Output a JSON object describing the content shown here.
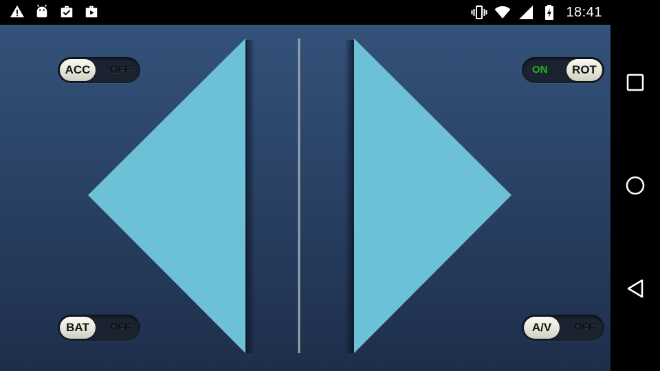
{
  "status_bar": {
    "time": "18:41",
    "left_icons": [
      "warning-icon",
      "android-icon",
      "briefcase-check-icon",
      "briefcase-play-icon"
    ],
    "right_icons": [
      "vibrate-icon",
      "wifi-icon",
      "cell-signal-icon",
      "battery-charging-icon"
    ]
  },
  "controls": {
    "acc": {
      "label": "ACC",
      "state": "OFF",
      "on": false
    },
    "rot": {
      "label": "ROT",
      "state": "ON",
      "on": true
    },
    "bat": {
      "label": "BAT",
      "state": "OFF",
      "on": false
    },
    "av": {
      "label": "A/V",
      "state": "OFF",
      "on": false
    }
  },
  "arrows": {
    "color": "#6cc1d6",
    "left": "left-arrow",
    "right": "right-arrow"
  },
  "colors": {
    "background_top": "#34527a",
    "background_bottom": "#1e2e4a",
    "on_state": "#21b81f",
    "divider": "#9aa3ad"
  },
  "nav_bar": {
    "buttons": [
      "recents-button",
      "home-button",
      "back-button"
    ]
  }
}
